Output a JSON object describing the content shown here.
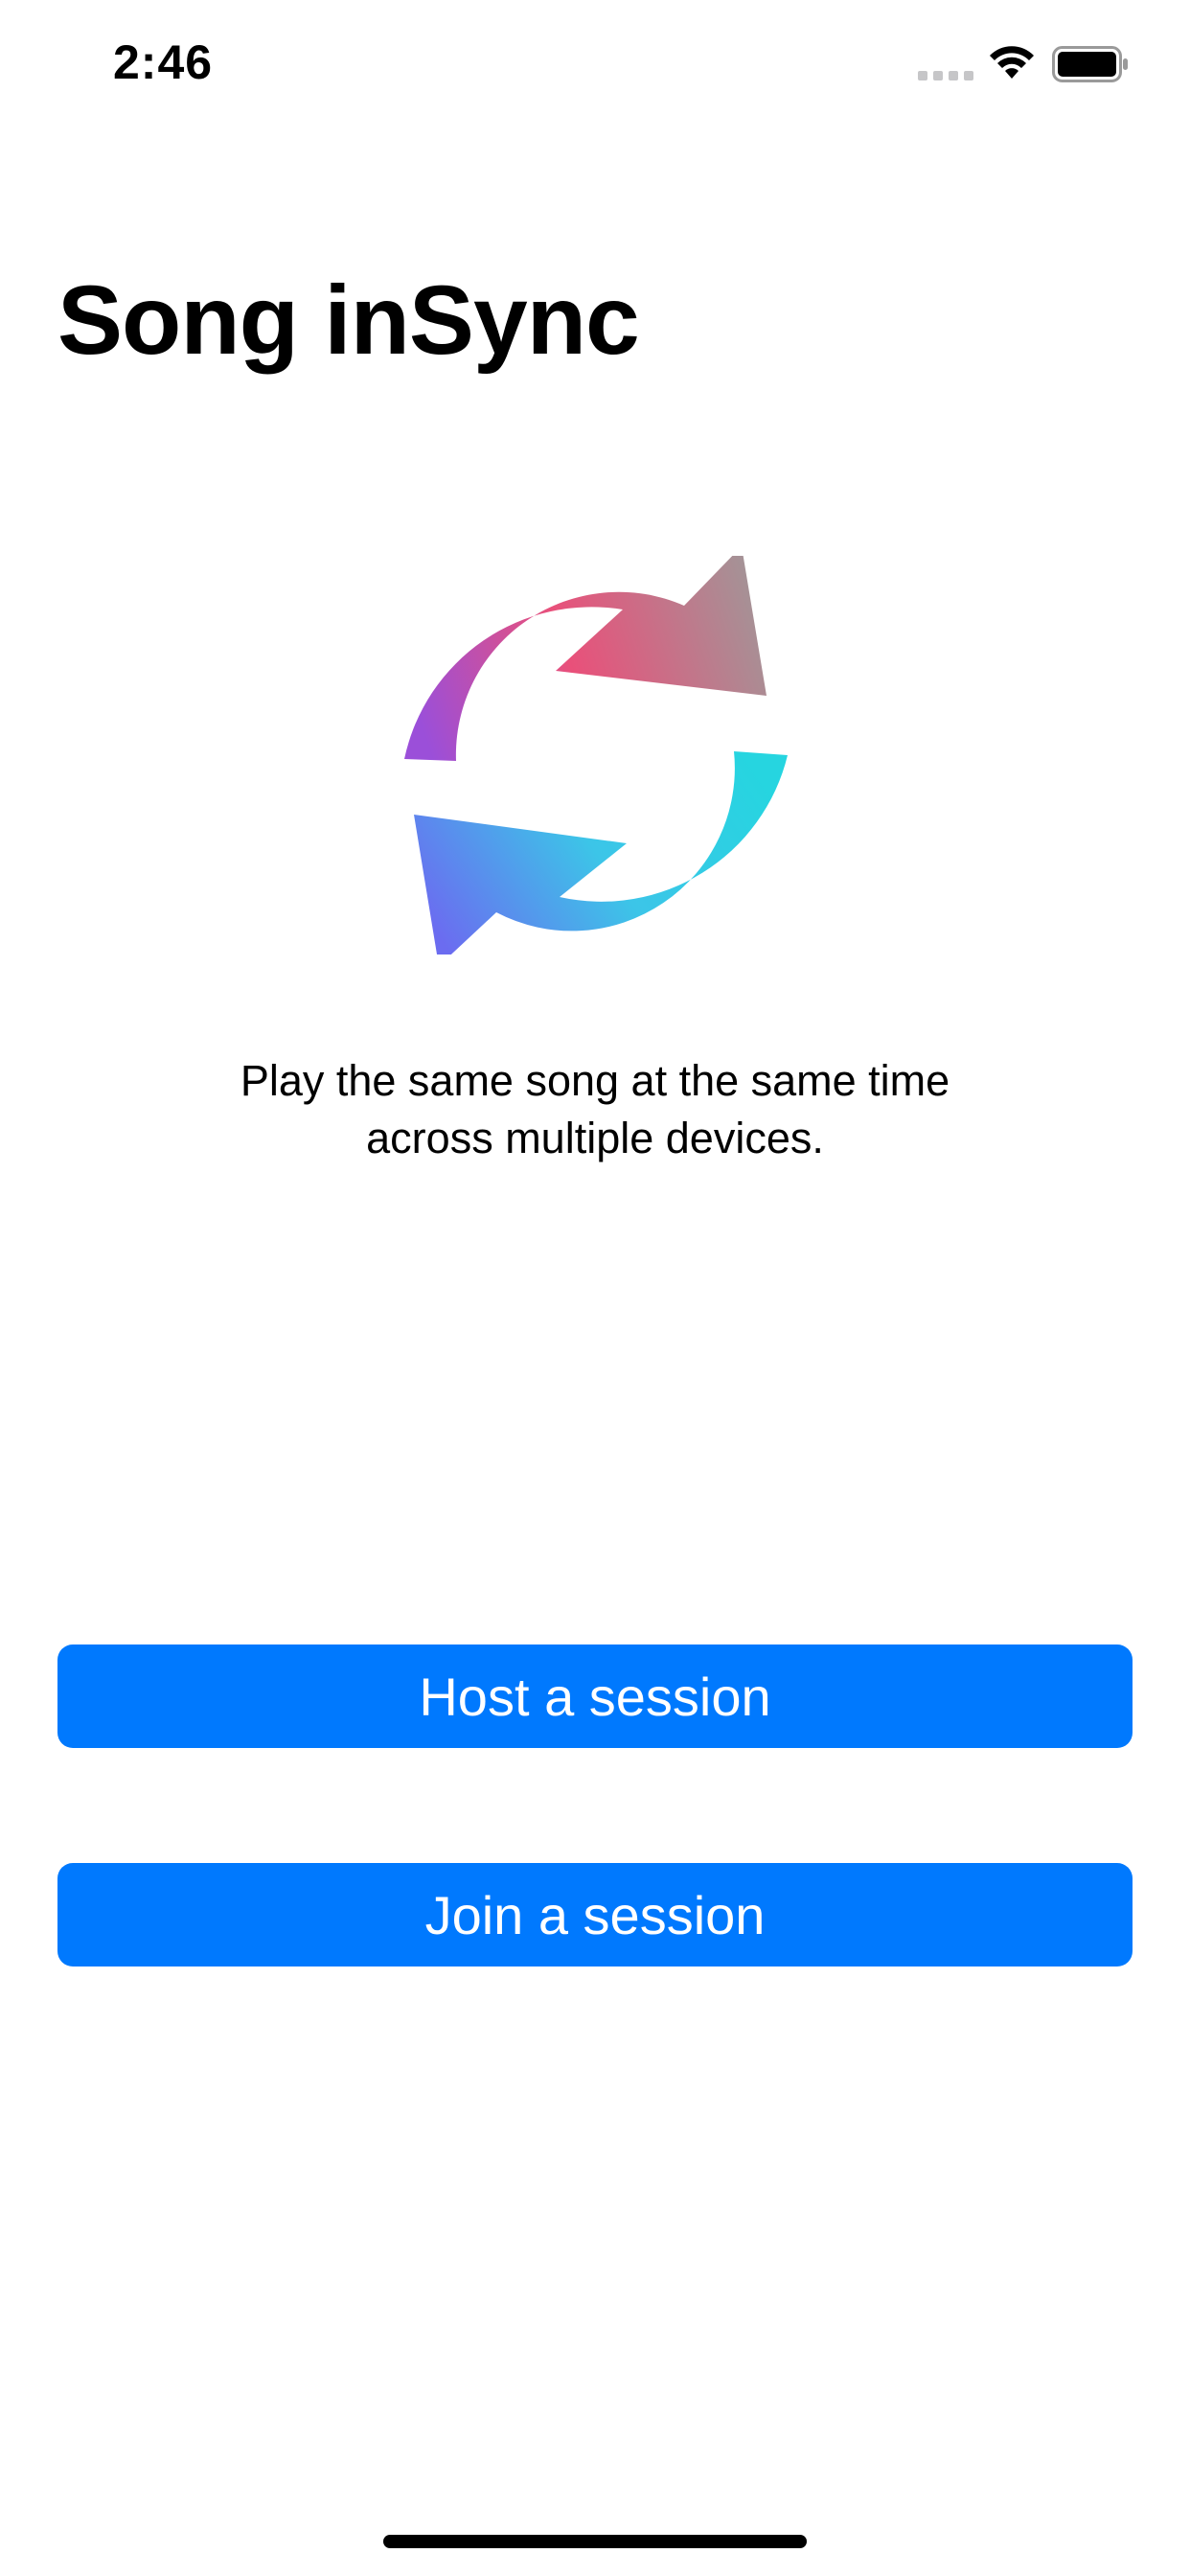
{
  "status_bar": {
    "time": "2:46",
    "signal_icon": "cellular-signal-dots-icon",
    "wifi_icon": "wifi-icon",
    "battery_icon": "battery-full-icon"
  },
  "header": {
    "title": "Song inSync"
  },
  "logo": {
    "icon": "sync-arrows-icon",
    "gradient_colors": [
      "#9b4fd9",
      "#e9507a",
      "#a59296",
      "#26d5e0",
      "#6b6cf0"
    ]
  },
  "tagline": {
    "line1": "Play the same song at the same time",
    "line2": "across multiple devices."
  },
  "actions": {
    "host_label": "Host a session",
    "join_label": "Join a session",
    "button_color": "#0079fe"
  }
}
